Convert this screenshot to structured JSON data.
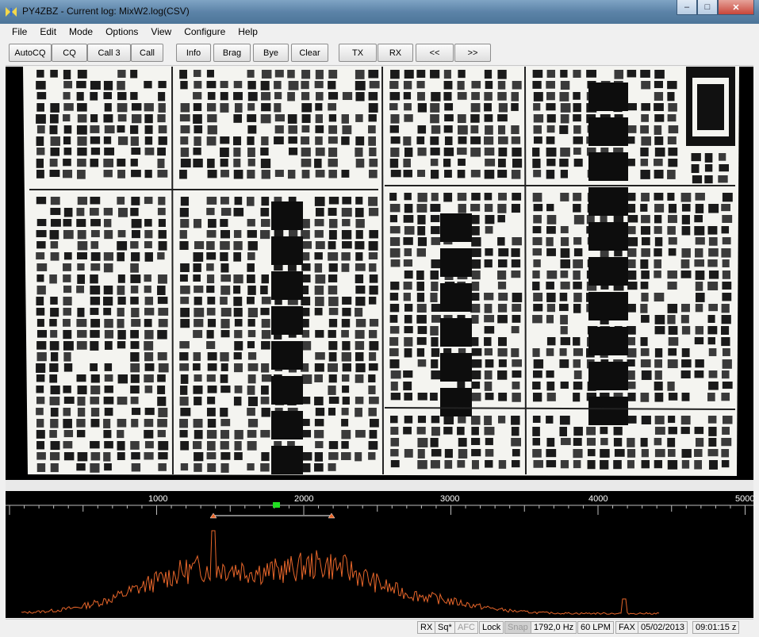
{
  "window": {
    "title": "PY4ZBZ - Current log: MixW2.log(CSV)",
    "minimize": "–",
    "maximize": "□",
    "close": "✕"
  },
  "menu": [
    "File",
    "Edit",
    "Mode",
    "Options",
    "View",
    "Configure",
    "Help"
  ],
  "toolbar": [
    "AutoCQ",
    "CQ",
    "Call 3",
    "Call",
    "Info",
    "Brag",
    "Bye",
    "Clear",
    "TX",
    "RX",
    "<<",
    ">>"
  ],
  "spectrum": {
    "ticks": [
      "1000",
      "2000",
      "3000",
      "4000",
      "5000"
    ],
    "trace_color": "#e8662a"
  },
  "status": {
    "rx": "RX",
    "sq": "Sq*",
    "afc": "AFC",
    "lock": "Lock",
    "snap": "Snap",
    "freq": "1792,0 Hz",
    "lpm": "60 LPM",
    "mode": "FAX",
    "date": "05/02/2013",
    "time": "09:01:15 z"
  }
}
